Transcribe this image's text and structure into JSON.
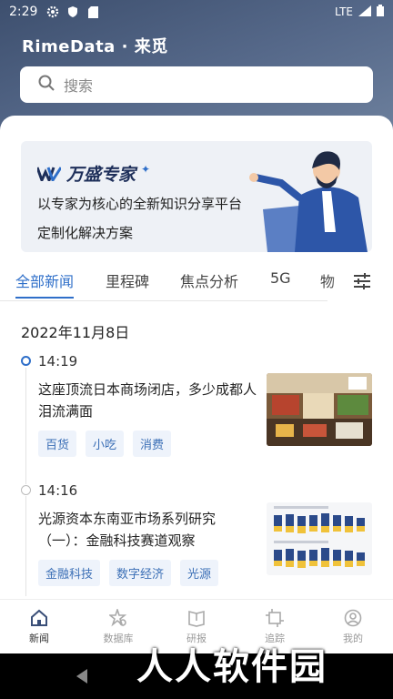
{
  "status": {
    "time": "2:29",
    "network": "LTE"
  },
  "brand": "RimeData · 来觅",
  "search": {
    "placeholder": "搜索"
  },
  "banner": {
    "logo_name": "万盛专家",
    "tagline": "以专家为核心的全新知识分享平台",
    "subline": "定制化解决方案"
  },
  "tabs": [
    "全部新闻",
    "里程碑",
    "焦点分析",
    "5G",
    "物"
  ],
  "date": "2022年11月8日",
  "news": [
    {
      "time": "14:19",
      "title": "这座顶流日本商场闭店，多少成都人泪流满面",
      "tags": [
        "百货",
        "小吃",
        "消费"
      ]
    },
    {
      "time": "14:16",
      "title": "光源资本东南亚市场系列研究（一）：金融科技赛道观察",
      "tags": [
        "金融科技",
        "数字经济",
        "光源"
      ]
    }
  ],
  "nav": [
    "新闻",
    "数据库",
    "研报",
    "追踪",
    "我的"
  ],
  "watermark": "人人软件园",
  "colors": {
    "accent": "#2f6fc9",
    "header": "#3d4f6e"
  }
}
